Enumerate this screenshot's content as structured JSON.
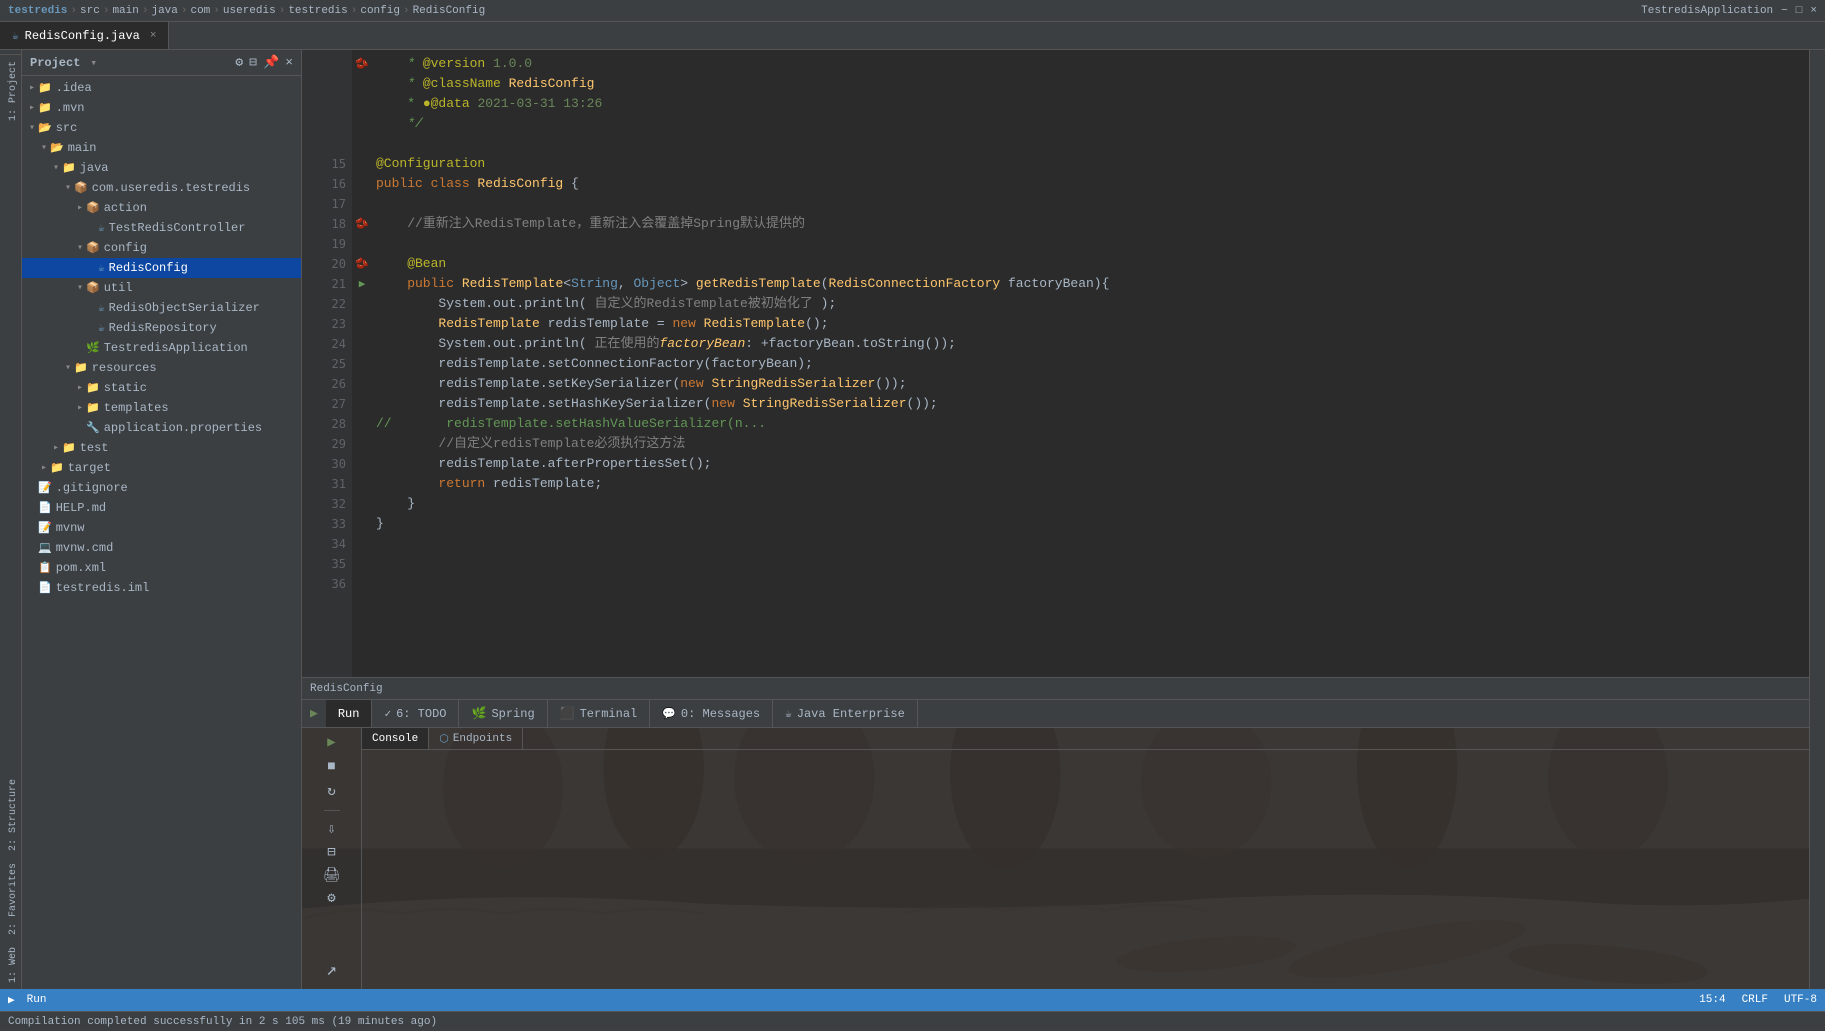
{
  "titlebar": {
    "segments": [
      "testredis",
      "src",
      "main",
      "java",
      "com",
      "useredis",
      "testredis",
      "config",
      "RedisConfig"
    ],
    "app_name": "TestredisApplication",
    "controls": [
      "minimize",
      "maximize",
      "close"
    ]
  },
  "tabs": [
    {
      "label": "RedisConfig.java",
      "icon": "java-icon",
      "active": true
    }
  ],
  "breadcrumb": {
    "path": "RedisConfig"
  },
  "project": {
    "title": "Project",
    "tree": [
      {
        "indent": 1,
        "type": "folder-open",
        "name": ".idea",
        "arrow": "▸"
      },
      {
        "indent": 1,
        "type": "folder-open",
        "name": ".mvn",
        "arrow": "▸"
      },
      {
        "indent": 1,
        "type": "folder-open",
        "name": "src",
        "arrow": "▾"
      },
      {
        "indent": 2,
        "type": "folder-open",
        "name": "main",
        "arrow": "▾"
      },
      {
        "indent": 3,
        "type": "folder-open",
        "name": "java",
        "arrow": "▾"
      },
      {
        "indent": 4,
        "type": "folder-open",
        "name": "com.useredis.testredis",
        "arrow": "▾"
      },
      {
        "indent": 5,
        "type": "folder-open",
        "name": "action",
        "arrow": "▸"
      },
      {
        "indent": 6,
        "type": "java-file",
        "name": "TestRedisController",
        "arrow": ""
      },
      {
        "indent": 5,
        "type": "folder-open",
        "name": "config",
        "arrow": "▾"
      },
      {
        "indent": 6,
        "type": "java-file",
        "name": "RedisConfig",
        "arrow": "",
        "selected": true
      },
      {
        "indent": 5,
        "type": "folder-open",
        "name": "util",
        "arrow": "▾"
      },
      {
        "indent": 6,
        "type": "java-file",
        "name": "RedisObjectSerializer",
        "arrow": ""
      },
      {
        "indent": 6,
        "type": "java-file",
        "name": "RedisRepository",
        "arrow": ""
      },
      {
        "indent": 5,
        "type": "java-file",
        "name": "TestredisApplication",
        "arrow": ""
      },
      {
        "indent": 4,
        "type": "folder-open",
        "name": "resources",
        "arrow": "▾"
      },
      {
        "indent": 5,
        "type": "folder-open",
        "name": "static",
        "arrow": "▸"
      },
      {
        "indent": 5,
        "type": "folder-open",
        "name": "templates",
        "arrow": "▸"
      },
      {
        "indent": 5,
        "type": "properties-file",
        "name": "application.properties",
        "arrow": ""
      },
      {
        "indent": 3,
        "type": "folder-open",
        "name": "test",
        "arrow": "▸"
      },
      {
        "indent": 2,
        "type": "folder-open",
        "name": "target",
        "arrow": "▸"
      },
      {
        "indent": 1,
        "type": "text-file",
        "name": ".gitignore",
        "arrow": ""
      },
      {
        "indent": 1,
        "type": "text-file",
        "name": "HELP.md",
        "arrow": ""
      },
      {
        "indent": 1,
        "type": "text-file",
        "name": "mvnw",
        "arrow": ""
      },
      {
        "indent": 1,
        "type": "text-file",
        "name": "mvnw.cmd",
        "arrow": ""
      },
      {
        "indent": 1,
        "type": "xml-file",
        "name": "pom.xml",
        "arrow": ""
      },
      {
        "indent": 1,
        "type": "xml-file",
        "name": "testredis.iml",
        "arrow": ""
      }
    ]
  },
  "code": {
    "filename": "RedisConfig.java",
    "lines": [
      {
        "num": "",
        "gutter": "▶",
        "content": ""
      },
      {
        "num": "",
        "gutter": "▶",
        "content": ""
      },
      {
        "num": "",
        "gutter": "",
        "content": "    * @version 1.0.0"
      },
      {
        "num": "",
        "gutter": "",
        "content": "    * @className RedisConfig"
      },
      {
        "num": "",
        "gutter": "",
        "content": "    * @data 2021-03-31 13:26"
      },
      {
        "num": "",
        "gutter": "",
        "content": "    */"
      },
      {
        "num": "15",
        "gutter": "",
        "content": ""
      },
      {
        "num": "",
        "gutter": "",
        "content": "@Configuration"
      },
      {
        "num": "",
        "gutter": "",
        "content": "public class RedisConfig {"
      },
      {
        "num": "",
        "gutter": "",
        "content": ""
      },
      {
        "num": "",
        "gutter": "▶",
        "content": "    //重新注入RedisTemplate，重新注入会覆盖掉Spring默认提供的"
      },
      {
        "num": "",
        "gutter": "",
        "content": ""
      },
      {
        "num": "",
        "gutter": "",
        "content": "    @Bean"
      },
      {
        "num": "",
        "gutter": "",
        "content": "    public RedisTemplate<String, Object> getRedisTemplate(RedisConnectionFactory factoryBean){"
      },
      {
        "num": "",
        "gutter": "",
        "content": "        System.out.println( 自定义的RedisTemplate被初始化了 );"
      },
      {
        "num": "",
        "gutter": "",
        "content": "        RedisTemplate redisTemplate = new RedisTemplate();"
      },
      {
        "num": "",
        "gutter": "",
        "content": "        System.out.println( 正在使用的factoryBean: +factoryBean.toString());"
      },
      {
        "num": "",
        "gutter": "",
        "content": "        redisTemplate.setConnectionFactory(factoryBean);"
      },
      {
        "num": "",
        "gutter": "",
        "content": "        redisTemplate.setKeySerializer(new StringRedisSerializer());"
      },
      {
        "num": "",
        "gutter": "",
        "content": "        redisTemplate.setHashKeySerializer(new StringRedisSerializer());"
      },
      {
        "num": "",
        "gutter": "",
        "content": "//          redisTemplate.setHashValueSerializer(n..."
      },
      {
        "num": "",
        "gutter": "",
        "content": "        //自定义redisTemplate必须执行这方法"
      },
      {
        "num": "",
        "gutter": "",
        "content": "        redisTemplate.afterPropertiesSet();"
      },
      {
        "num": "",
        "gutter": "",
        "content": "        return redisTemplate;"
      },
      {
        "num": "",
        "gutter": "",
        "content": "    }"
      },
      {
        "num": "",
        "gutter": "",
        "content": "}"
      }
    ]
  },
  "run_panel": {
    "active_tab": "Run",
    "tabs": [
      "Run",
      "6: TODO",
      "Spring",
      "Terminal",
      "0: Messages",
      "Java Enterprise"
    ],
    "run_config": "TestredisApplication",
    "console_label": "Console",
    "endpoints_label": "Endpoints"
  },
  "status_bar": {
    "run_label": "Run",
    "position": "15:4",
    "line_ending": "CRLF",
    "encoding": "UTF-8",
    "bottom_message": "Compilation completed successfully in 2 s 105 ms (19 minutes ago)"
  },
  "icons": {
    "play": "▶",
    "stop": "■",
    "settings": "⚙",
    "split": "⊟",
    "pin": "📌",
    "close": "×",
    "arrow_down": "▾",
    "arrow_right": "▸",
    "folder": "📁",
    "java": "☕",
    "xml": "📄",
    "properties": "📋",
    "text": "📝",
    "spring": "🌿",
    "bean": "🫘",
    "refresh": "↻"
  }
}
